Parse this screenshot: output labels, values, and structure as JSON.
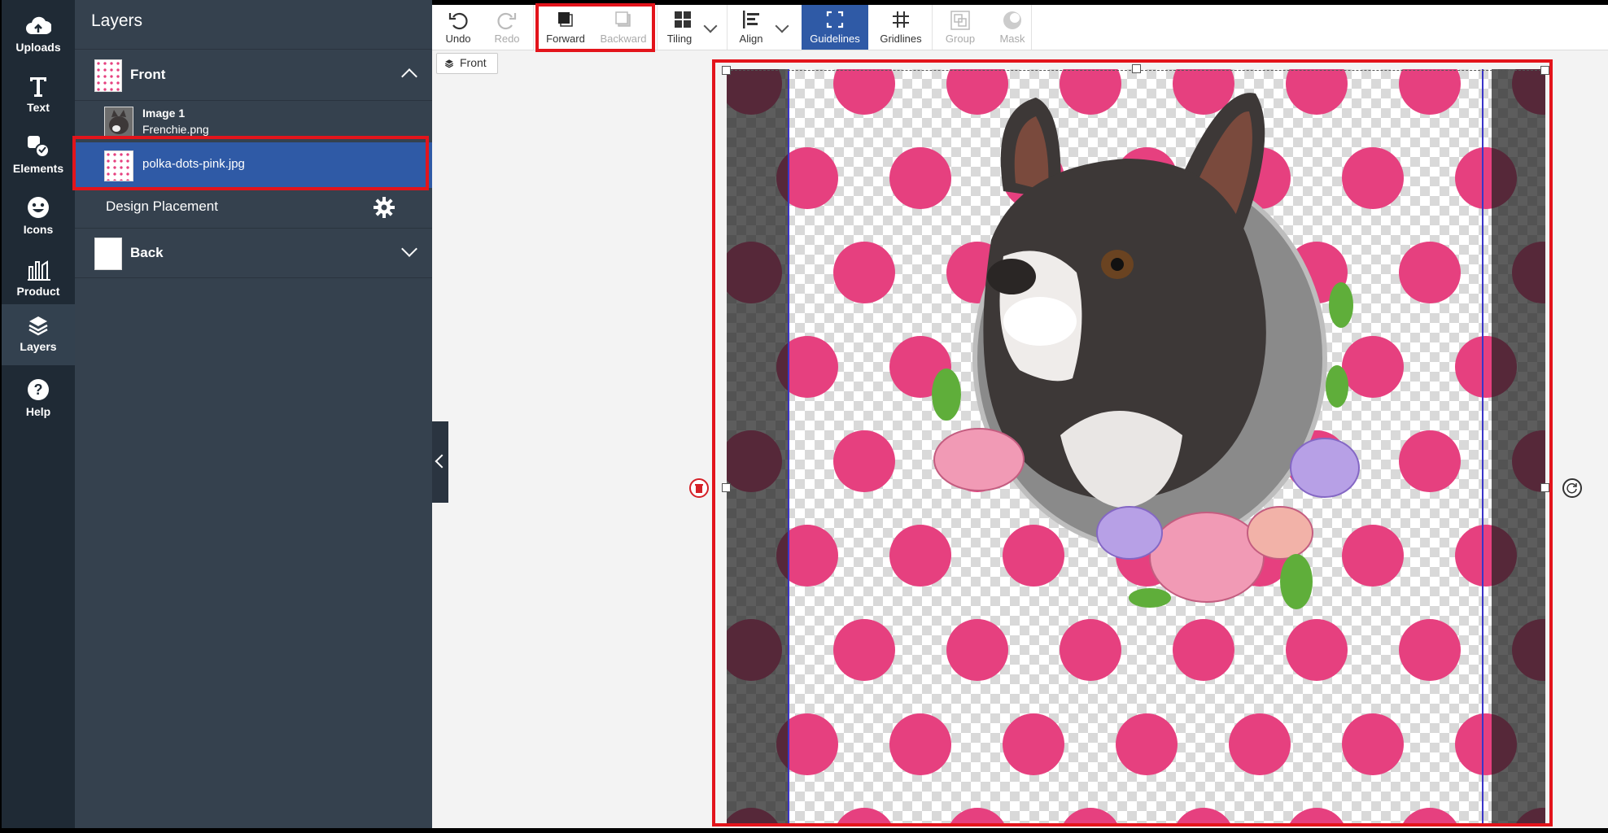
{
  "rail": {
    "items": [
      {
        "label": "Uploads",
        "icon": "cloud-upload-icon"
      },
      {
        "label": "Text",
        "icon": "text-icon"
      },
      {
        "label": "Elements",
        "icon": "elements-icon"
      },
      {
        "label": "Icons",
        "icon": "smiley-icon"
      },
      {
        "label": "Product",
        "icon": "product-icon"
      },
      {
        "label": "Layers",
        "icon": "layers-icon",
        "active": true
      },
      {
        "label": "Help",
        "icon": "help-icon"
      }
    ]
  },
  "panel": {
    "title": "Layers",
    "front": {
      "label": "Front",
      "expanded": true
    },
    "layers": [
      {
        "name": "Image 1",
        "file": "Frenchie.png"
      },
      {
        "name": "polka-dots-pink.jpg",
        "selected": true
      }
    ],
    "design_placement": "Design Placement",
    "back": {
      "label": "Back",
      "expanded": false
    }
  },
  "toolbar": {
    "undo": "Undo",
    "redo": "Redo",
    "forward": "Forward",
    "backward": "Backward",
    "tiling": "Tiling",
    "align": "Align",
    "guidelines": "Guidelines",
    "gridlines": "Gridlines",
    "group": "Group",
    "mask": "Mask"
  },
  "canvas": {
    "side_tag": "Front"
  },
  "colors": {
    "rail_bg": "#1f2a35",
    "panel_bg": "#35414e",
    "selected_layer": "#2f5aa6",
    "active_tool": "#2f5aa6",
    "highlight": "#e3141b",
    "polka_dot": "#e6407f",
    "guideline": "#3a35c8"
  }
}
